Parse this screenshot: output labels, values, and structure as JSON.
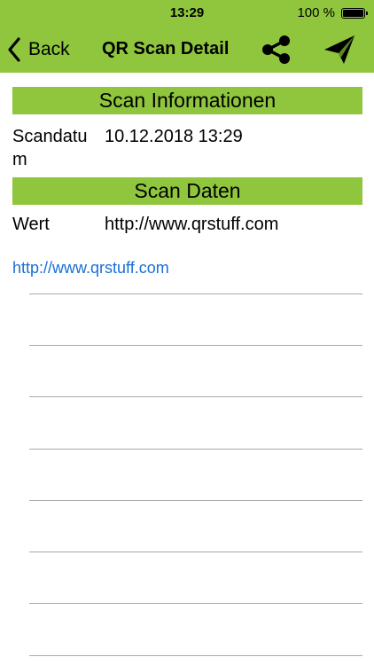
{
  "status_bar": {
    "time": "13:29",
    "battery_text": "100 %"
  },
  "nav": {
    "back_label": "Back",
    "title": "QR Scan Detail"
  },
  "icons": {
    "back": "chevron-left-icon",
    "share": "share-icon",
    "send": "paper-plane-icon"
  },
  "section_info": {
    "title": "Scan Informationen",
    "date_label_line1": "Scandatu",
    "date_label_line2": "m",
    "date_value": "10.12.2018 13:29"
  },
  "section_data": {
    "title": "Scan Daten",
    "value_label": "Wert",
    "value": "http://www.qrstuff.com",
    "link": "http://www.qrstuff.com"
  },
  "colors": {
    "accent": "#8fc63e",
    "link": "#1a6fd6",
    "rule": "#a9a9a9"
  }
}
